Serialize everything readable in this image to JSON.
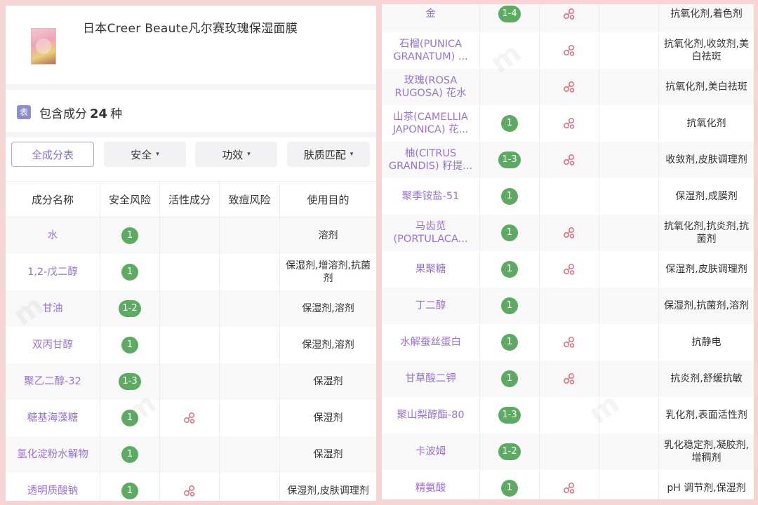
{
  "product": {
    "title": "日本Creer Beaute凡尔赛玫瑰保湿面膜"
  },
  "summary": {
    "icon_char": "表",
    "prefix": "包含成分",
    "count": "24",
    "suffix": "种"
  },
  "filters": [
    {
      "label": "全成分表",
      "active": true
    },
    {
      "label": "安全",
      "caret": "▾"
    },
    {
      "label": "功效",
      "caret": "▾"
    },
    {
      "label": "肤质匹配",
      "caret": "▾"
    }
  ],
  "table": {
    "headers": [
      "成分名称",
      "安全风险",
      "活性成分",
      "致痘风险",
      "使用目的"
    ],
    "left_rows": [
      {
        "name": "水",
        "risk": "1",
        "active": false,
        "purpose": "溶剂"
      },
      {
        "name": "1,2-戊二醇",
        "risk": "1",
        "active": false,
        "purpose": "保湿剂,增溶剂,抗菌剂"
      },
      {
        "name": "甘油",
        "risk": "1-2",
        "active": false,
        "purpose": "保湿剂,溶剂"
      },
      {
        "name": "双丙甘醇",
        "risk": "1",
        "active": false,
        "purpose": "保湿剂,溶剂"
      },
      {
        "name": "聚乙二醇-32",
        "risk": "1-3",
        "active": false,
        "purpose": "保湿剂"
      },
      {
        "name": "糖基海藻糖",
        "risk": "1",
        "active": true,
        "purpose": "保湿剂"
      },
      {
        "name": "氢化淀粉水解物",
        "risk": "1",
        "active": false,
        "purpose": "保湿剂"
      },
      {
        "name": "透明质酸钠",
        "risk": "1",
        "active": true,
        "purpose": "保湿剂,皮肤调理剂"
      }
    ],
    "right_rows": [
      {
        "name": "金",
        "risk": "1-4",
        "active": true,
        "purpose": "抗氧化剂,着色剂"
      },
      {
        "name": "石榴(PUNICA GRANATUM) ...",
        "risk": "",
        "active": true,
        "purpose": "抗氧化剂,收敛剂,美白祛斑"
      },
      {
        "name": "玫瑰(ROSA RUGOSA) 花水",
        "risk": "",
        "active": true,
        "purpose": "抗氧化剂,美白祛斑"
      },
      {
        "name": "山茶(CAMELLIA JAPONICA) 花...",
        "risk": "1",
        "active": true,
        "purpose": "抗氧化剂"
      },
      {
        "name": "柚(CITRUS GRANDIS) 籽提...",
        "risk": "1-3",
        "active": true,
        "purpose": "收敛剂,皮肤调理剂"
      },
      {
        "name": "聚季铵盐-51",
        "risk": "1",
        "active": false,
        "purpose": "保湿剂,成膜剂"
      },
      {
        "name": "马齿苋 (PORTULACA...",
        "risk": "1",
        "active": true,
        "purpose": "抗氧化剂,抗炎剂,抗菌剂"
      },
      {
        "name": "果聚糖",
        "risk": "1",
        "active": true,
        "purpose": "保湿剂,皮肤调理剂"
      },
      {
        "name": "丁二醇",
        "risk": "1",
        "active": false,
        "purpose": "保湿剂,抗菌剂,溶剂"
      },
      {
        "name": "水解蚕丝蛋白",
        "risk": "1",
        "active": true,
        "purpose": "抗静电"
      },
      {
        "name": "甘草酸二钾",
        "risk": "1",
        "active": true,
        "purpose": "抗炎剂,舒缓抗敏"
      },
      {
        "name": "聚山梨醇酯-80",
        "risk": "1-3",
        "active": false,
        "purpose": "乳化剂,表面活性剂"
      },
      {
        "name": "卡波姆",
        "risk": "1-2",
        "active": false,
        "purpose": "乳化稳定剂,凝胶剂,增稠剂"
      },
      {
        "name": "精氨酸",
        "risk": "1",
        "active": true,
        "purpose": "pH 调节剂,保湿剂"
      }
    ]
  },
  "colors": {
    "accent": "#9a72d6",
    "badge": "#5dab62",
    "active_icon": "#e06b77",
    "page_bg": "#f6d4d4"
  },
  "icons": {
    "active_ingredient": "active-ingredient-icon",
    "table": "table-icon",
    "caret": "chevron-down-icon"
  }
}
